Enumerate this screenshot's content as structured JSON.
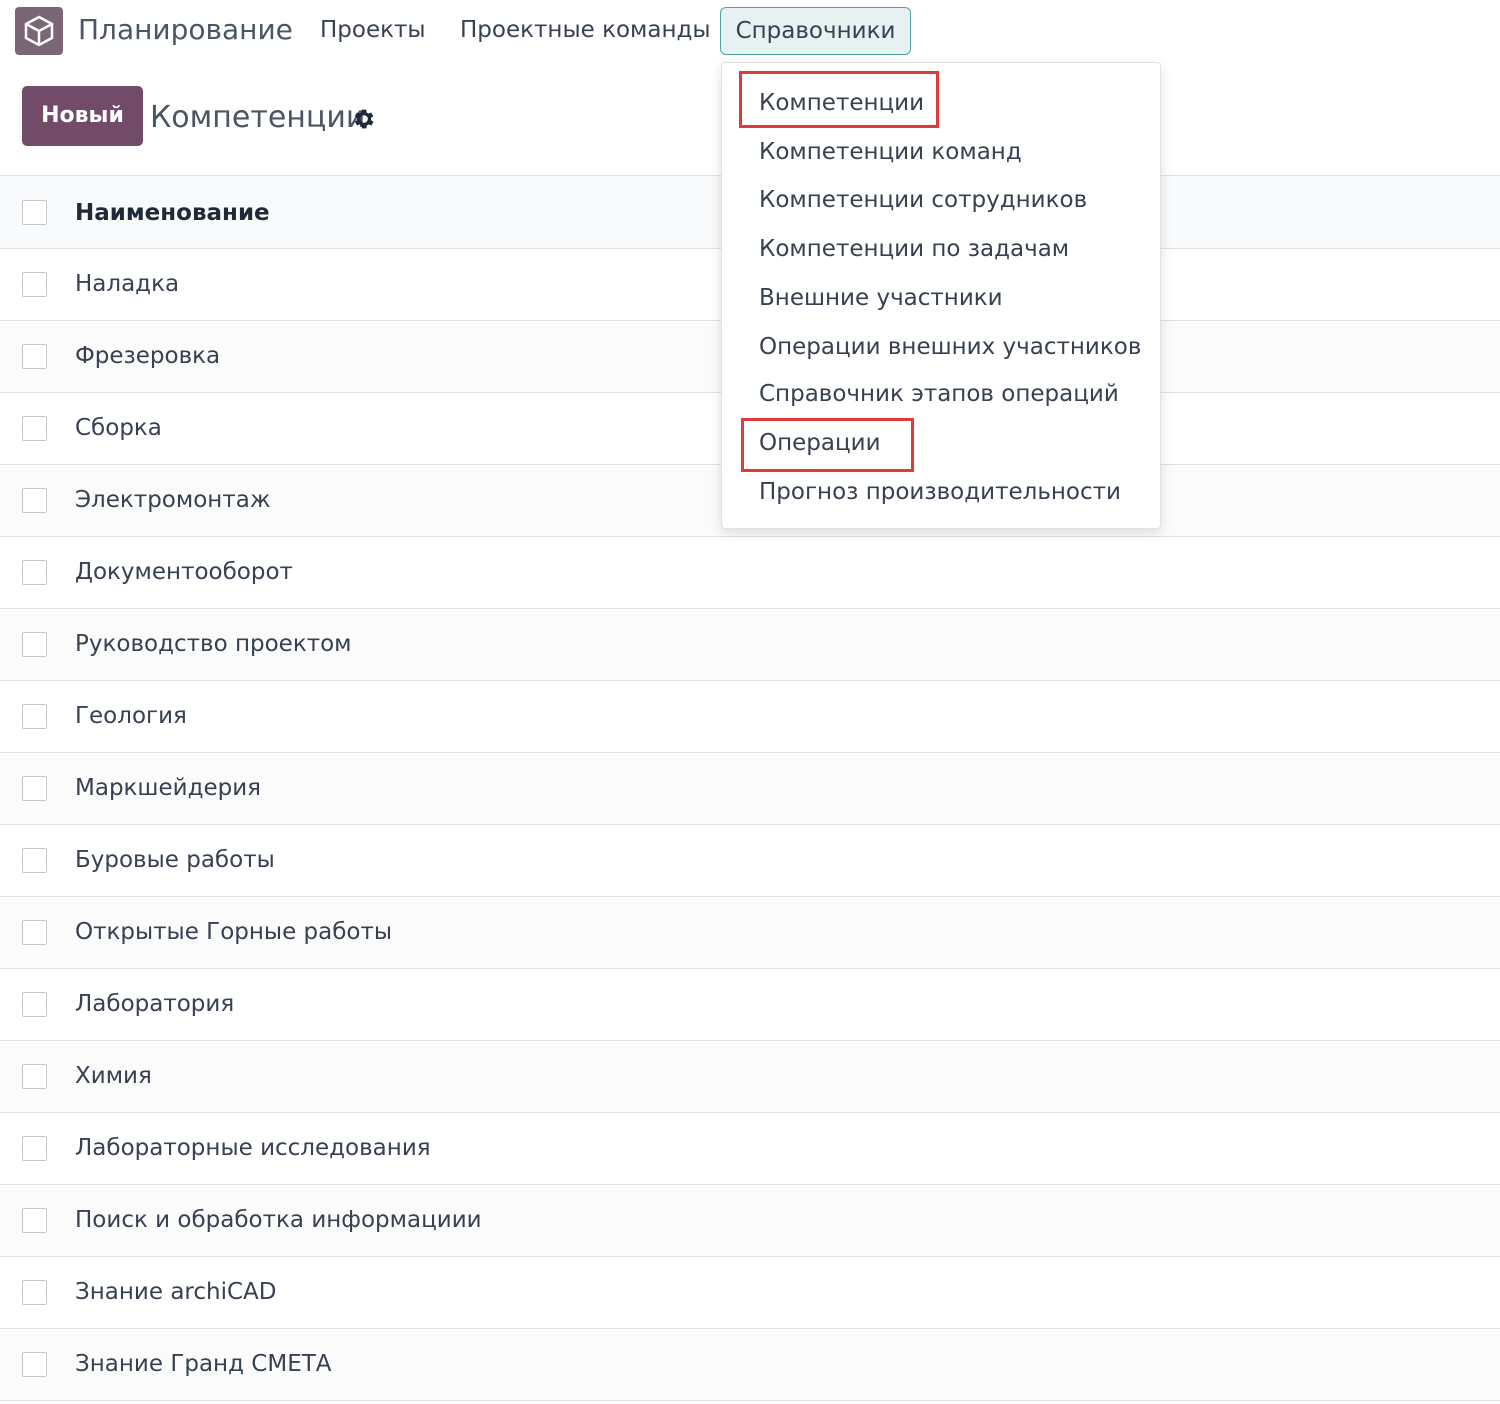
{
  "app": {
    "name": "Планирование",
    "icon": "app-cube-icon"
  },
  "nav": {
    "items": [
      {
        "label": "Проекты"
      },
      {
        "label": "Проектные команды"
      }
    ],
    "active": {
      "label": "Справочники"
    }
  },
  "control": {
    "new_label": "Новый",
    "title": "Компетенции",
    "settings_icon": "gear-icon"
  },
  "list": {
    "header": "Наименование",
    "rows": [
      "Наладка",
      "Фрезеровка",
      "Сборка",
      "Электромонтаж",
      "Документооборот",
      "Руководство проектом",
      "Геология",
      "Маркшейдерия",
      "Буровые работы",
      "Открытые Горные работы",
      "Лаборатория",
      "Химия",
      "Лабораторные исследования",
      "Поиск и обработка информациии",
      "Знание archiCAD",
      "Знание Гранд СМЕТА"
    ]
  },
  "dropdown": {
    "items": [
      "Компетенции",
      "Компетенции команд",
      "Компетенции сотрудников",
      "Компетенции по задачам",
      "Внешние участники",
      "Операции внешних участников",
      "Справочник этапов операций",
      "Операции",
      "Прогноз производительности"
    ]
  },
  "colors": {
    "brand": "#714b67",
    "active_nav_border": "#4fa3a5",
    "highlight": "#e03a3a"
  }
}
